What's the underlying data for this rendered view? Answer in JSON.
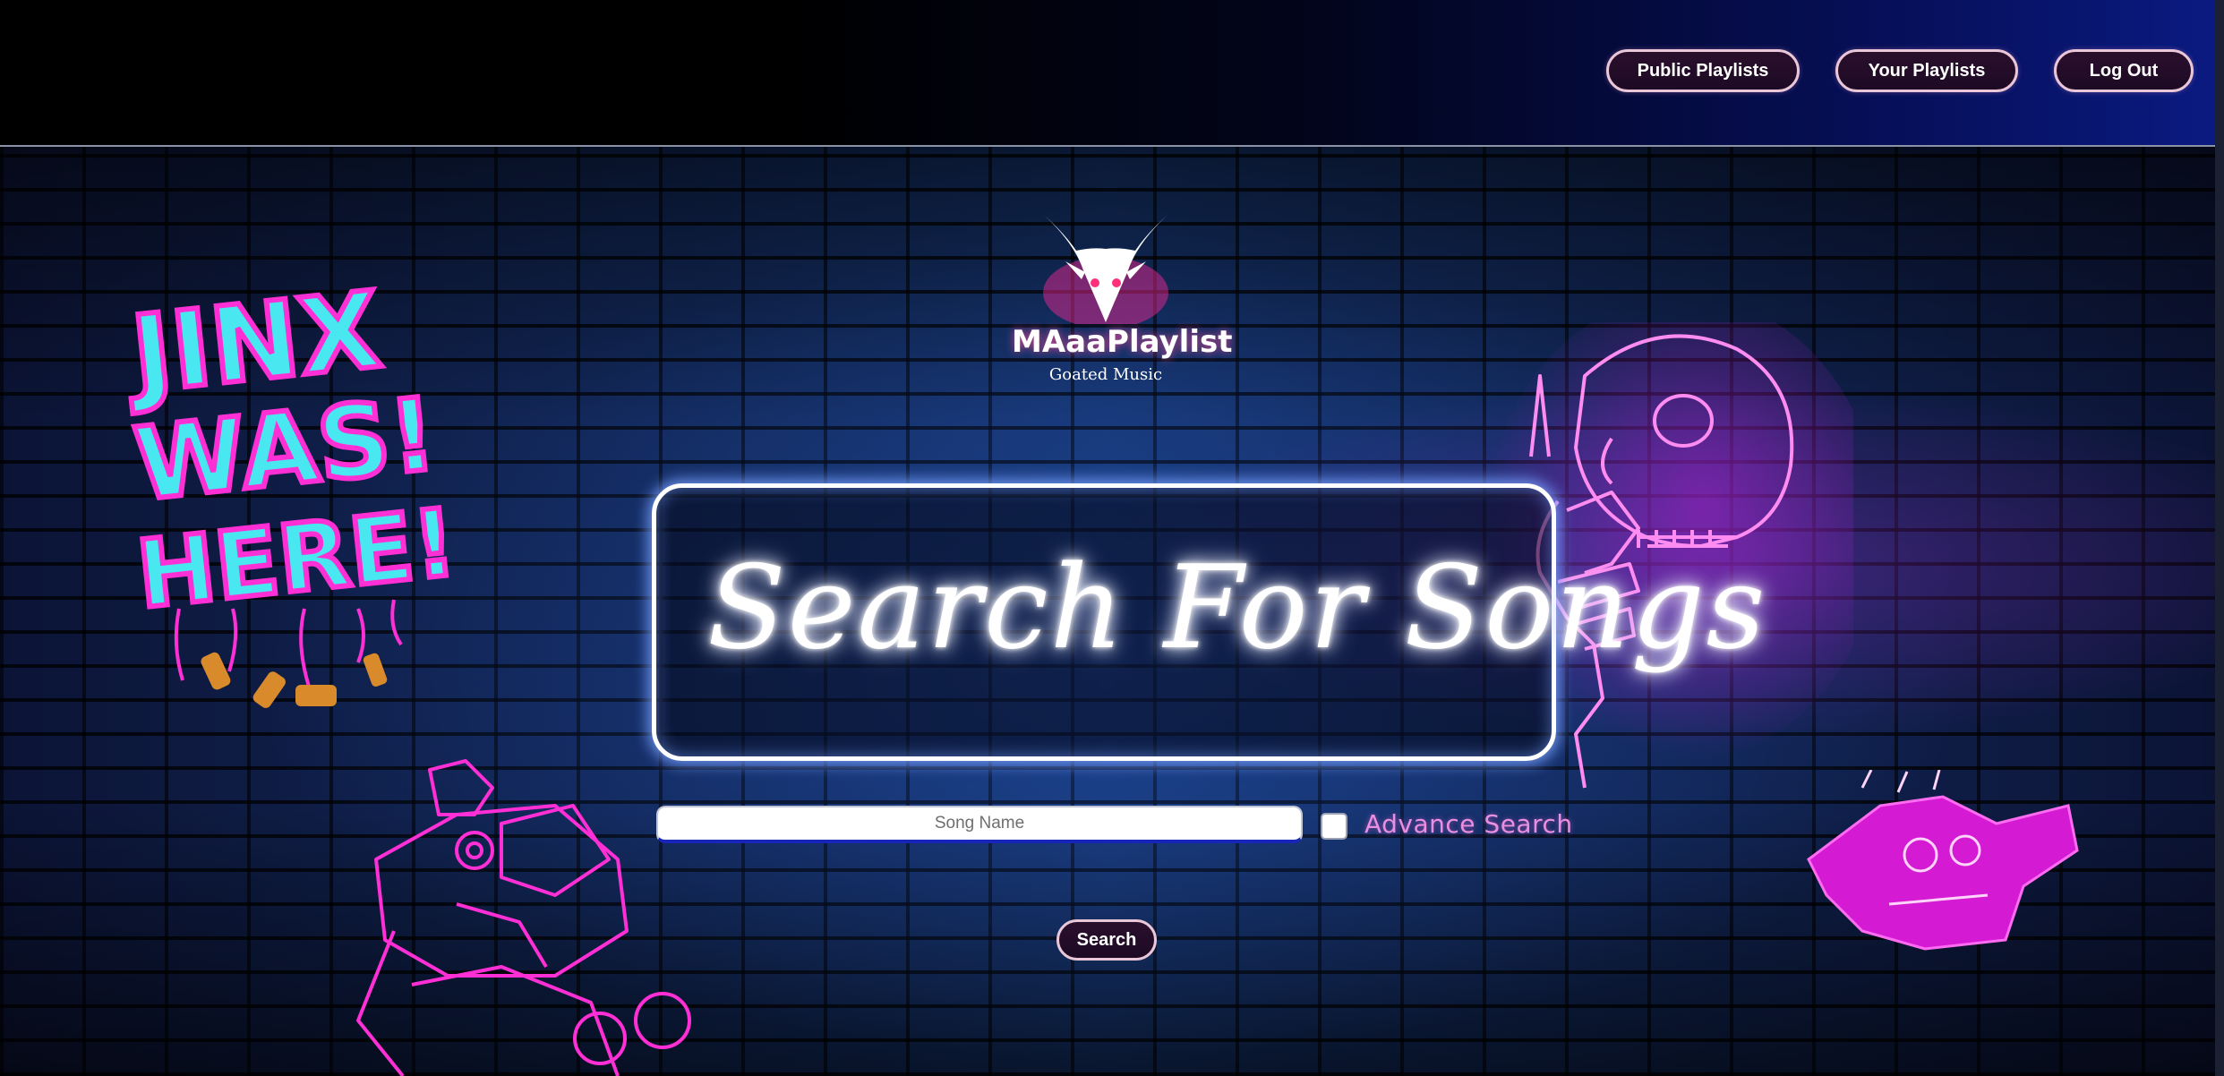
{
  "header": {
    "nav": {
      "public_playlists": "Public Playlists",
      "your_playlists": "Your Playlists",
      "log_out": "Log Out"
    }
  },
  "logo": {
    "title": "MAaaPlaylist",
    "subtitle": "Goated Music",
    "icon": "goat-head-icon"
  },
  "hero": {
    "sign_text": "Search For Songs"
  },
  "search": {
    "input_value": "",
    "input_placeholder": "Song Name",
    "advanced_checked": false,
    "advanced_label": "Advance Search",
    "submit_label": "Search"
  },
  "decorations": {
    "graffiti_text": "JINX WAS HERE!",
    "icons": [
      "skull-hand-icon",
      "robot-graffiti-icon",
      "monkey-graffiti-icon"
    ]
  },
  "colors": {
    "neon_pink": "#ff2fd6",
    "neon_cyan": "#49e8f0",
    "neon_white": "#ffffff",
    "adv_label": "#ea8fe0",
    "button_border": "#e9c6d8",
    "button_bg": "#1d0a24",
    "header_end": "#0a1a80"
  }
}
